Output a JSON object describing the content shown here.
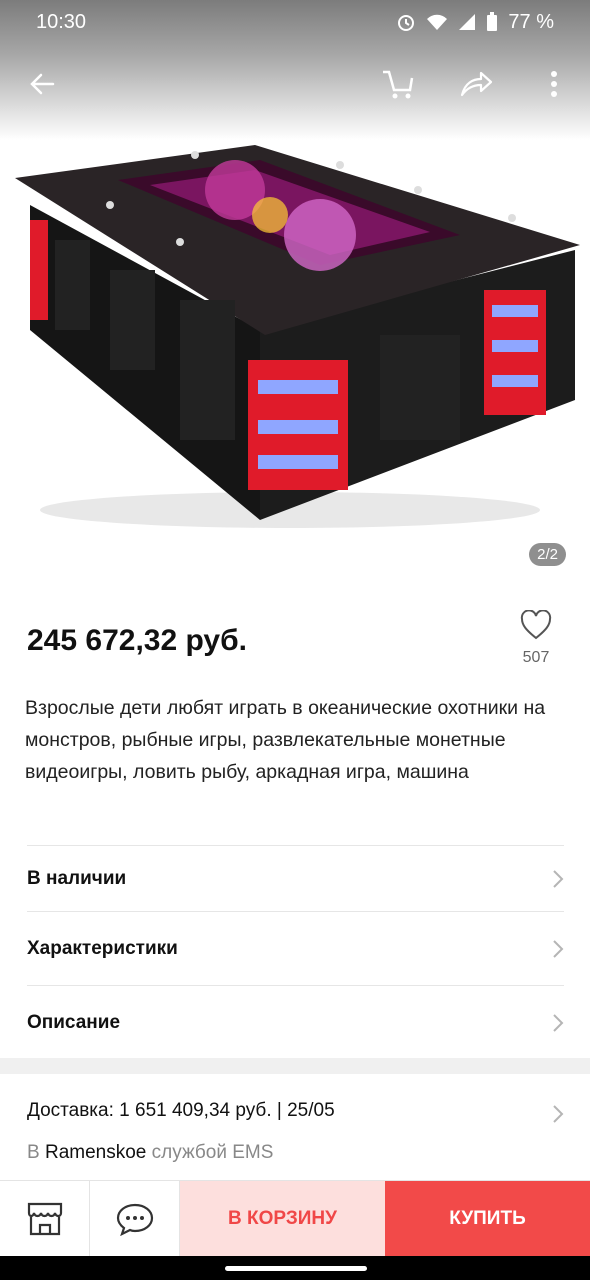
{
  "status_bar": {
    "time": "10:30",
    "battery": "77 %"
  },
  "gallery": {
    "counter": "2/2"
  },
  "product": {
    "price": "245 672,32 руб.",
    "favorites_count": "507",
    "title": "Взрослые дети любят играть в океанические охотники на монстров, рыбные игры, развлекательные монетные видеоигры, ловить рыбу, аркадная игра, машина"
  },
  "rows": [
    {
      "label": "В наличии"
    },
    {
      "label": "Характеристики"
    },
    {
      "label": "Описание"
    }
  ],
  "delivery": {
    "line": "Доставка: 1 651 409,34 руб. | 25/05",
    "prefix": "В",
    "city": "Ramenskoe",
    "suffix": "службой EMS"
  },
  "actions": {
    "cart_label": "В КОРЗИНУ",
    "buy_label": "КУПИТЬ"
  },
  "icons": [
    "back-arrow-icon",
    "cart-icon",
    "share-icon",
    "more-icon",
    "heart-icon",
    "chevron-right-icon",
    "store-icon",
    "chat-icon"
  ]
}
